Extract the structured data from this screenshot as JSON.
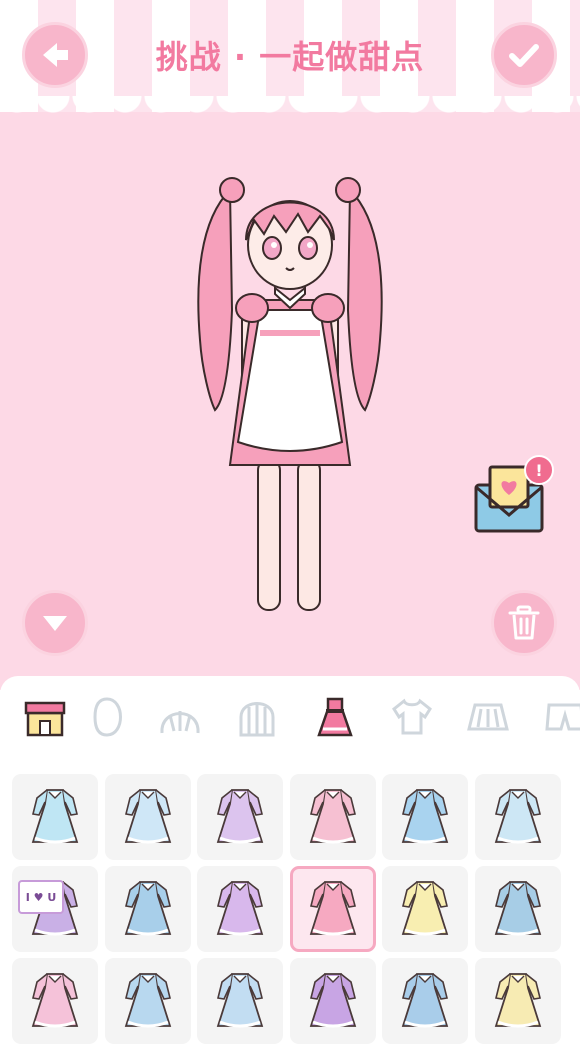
{
  "header": {
    "title": "挑战 · 一起做甜点",
    "back_icon": "arrow-left-icon",
    "confirm_icon": "checkmark-icon"
  },
  "stage": {
    "collapse_icon": "triangle-down-icon",
    "trash_icon": "trash-can-icon",
    "mail_icon": "love-letter-icon",
    "mail_badge": "!"
  },
  "tabs": [
    {
      "name": "shop",
      "icon": "shop-icon",
      "selected": false
    },
    {
      "name": "face",
      "icon": "face-icon",
      "selected": false
    },
    {
      "name": "front-hair",
      "icon": "front-hair-icon",
      "selected": false
    },
    {
      "name": "back-hair",
      "icon": "back-hair-icon",
      "selected": false
    },
    {
      "name": "dress",
      "icon": "dress-icon",
      "selected": true
    },
    {
      "name": "top",
      "icon": "shirt-icon",
      "selected": false
    },
    {
      "name": "skirt",
      "icon": "skirt-icon",
      "selected": false
    },
    {
      "name": "shorts",
      "icon": "shorts-icon",
      "selected": false
    }
  ],
  "items": [
    {
      "icon": "light-blue-gown-icon",
      "color": "#bfe6f4"
    },
    {
      "icon": "white-blue-frill-dress-icon",
      "color": "#cfe7f7"
    },
    {
      "icon": "lavender-ribbon-dress-icon",
      "color": "#dcc4ee"
    },
    {
      "icon": "pink-yellow-dress-icon",
      "color": "#f6c0d2"
    },
    {
      "icon": "blue-pinafore-dress-icon",
      "color": "#a9d3ef"
    },
    {
      "icon": "blue-bow-dress-icon",
      "color": "#cde7f5"
    },
    {
      "icon": "i-love-u-sign-dress-icon",
      "color": "#c9b0e6",
      "sign_text": "I ♥ U"
    },
    {
      "icon": "sailor-dress-icon",
      "color": "#a8cfea"
    },
    {
      "icon": "purple-sailor-dress-icon",
      "color": "#d8b8ec"
    },
    {
      "icon": "pink-white-apron-dress-icon",
      "color": "#f6a9c1",
      "selected": true
    },
    {
      "icon": "yellow-sweater-dress-icon",
      "color": "#f8eeb1"
    },
    {
      "icon": "blue-overall-dress-icon",
      "color": "#a7cde6"
    },
    {
      "icon": "pink-heart-dress-icon",
      "color": "#f5c2d9"
    },
    {
      "icon": "blue-long-dress-icon",
      "color": "#b8d8ef"
    },
    {
      "icon": "blue-ruffle-dress-icon",
      "color": "#c2ddf2"
    },
    {
      "icon": "purple-long-dress-icon",
      "color": "#c8a5e4"
    },
    {
      "icon": "blue-maxi-dress-icon",
      "color": "#a9cdea"
    },
    {
      "icon": "yellow-maxi-dress-icon",
      "color": "#f7ebb3"
    }
  ]
}
